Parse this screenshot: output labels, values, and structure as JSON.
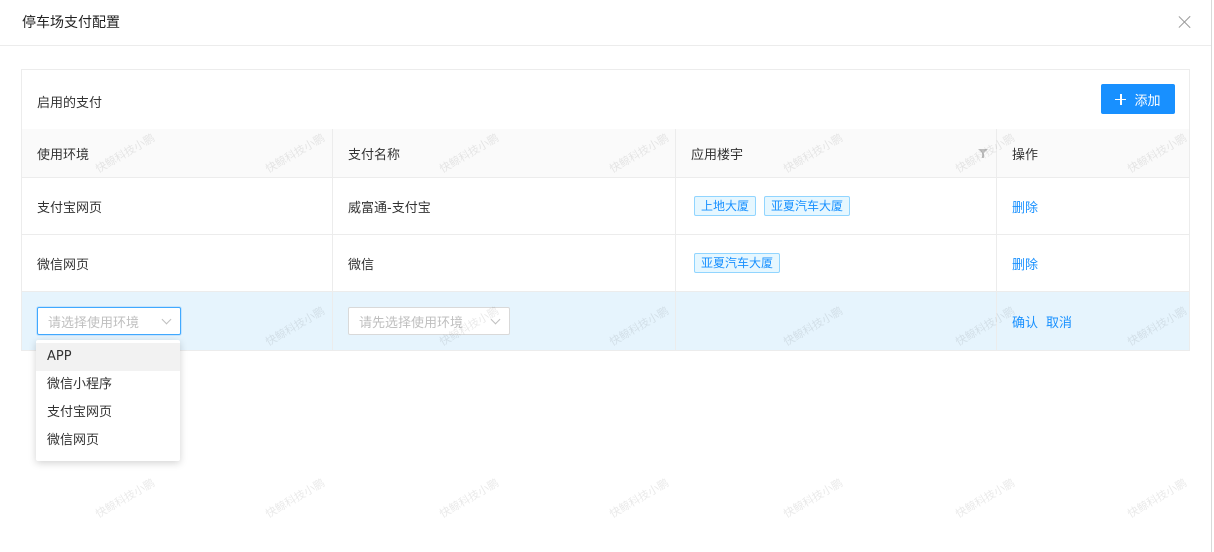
{
  "modal": {
    "title": "停车场支付配置"
  },
  "card": {
    "title": "启用的支付",
    "add_button_label": "添加"
  },
  "table": {
    "columns": [
      "使用环境",
      "支付名称",
      "应用楼宇",
      "操作"
    ],
    "rows": [
      {
        "env": "支付宝网页",
        "name": "威富通-支付宝",
        "buildings": [
          "上地大厦",
          "亚夏汽车大厦"
        ],
        "action": "删除"
      },
      {
        "env": "微信网页",
        "name": "微信",
        "buildings": [
          "亚夏汽车大厦"
        ],
        "action": "删除"
      }
    ],
    "edit_row": {
      "env_placeholder": "请选择使用环境",
      "name_placeholder": "请先选择使用环境",
      "confirm_label": "确认",
      "cancel_label": "取消"
    }
  },
  "dropdown": {
    "options": [
      "APP",
      "微信小程序",
      "支付宝网页",
      "微信网页"
    ],
    "hovered_index": 0
  },
  "watermark_text": "快鲸科技小鹏",
  "colors": {
    "primary": "#1890ff",
    "edit_row_bg": "#e6f4fd",
    "tag_bg": "#e6f7ff",
    "tag_border": "#91d5ff"
  }
}
